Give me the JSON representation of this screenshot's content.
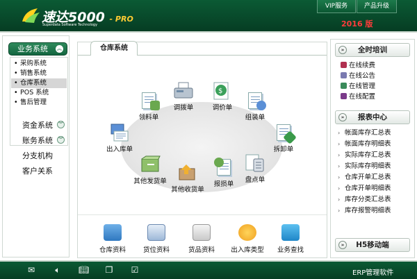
{
  "header": {
    "logo_main": "速达5000",
    "logo_suffix": "- PRO",
    "logo_sub": "Superdata Software Technology",
    "vip_button": "VIP服务",
    "upgrade_button": "产品升级",
    "year": "2016 版"
  },
  "sidebar": {
    "head": "业务系统",
    "sub_items": [
      "采购系统",
      "销售系统",
      "仓库系统",
      "POS 系统",
      "售后管理"
    ],
    "active_index": 2,
    "links": [
      "资金系统",
      "账务系统",
      "分支机构",
      "客户关系"
    ]
  },
  "center": {
    "tab": "仓库系统",
    "nodes": [
      "领料单",
      "调拨单",
      "调价单",
      "组装单",
      "出入库单",
      "拆卸单",
      "其他发货单",
      "其他收货单",
      "报损单",
      "盘点单"
    ],
    "quick": [
      "仓库资料",
      "货位资料",
      "货品资料",
      "出入库类型",
      "业务查找"
    ]
  },
  "right": {
    "training_head": "全时培训",
    "training_items": [
      "在线续费",
      "在线公告",
      "在线管理",
      "在线配置"
    ],
    "report_head": "报表中心",
    "report_items": [
      "帐面库存汇总表",
      "帐面库存明细表",
      "实际库存汇总表",
      "实际库存明细表",
      "仓库开单汇总表",
      "仓库开单明细表",
      "库存分类汇总表",
      "库存报警明细表"
    ],
    "mobile_head": "H5移动端"
  },
  "footer": {
    "label": "ERP管理软件"
  },
  "colors": {
    "brand_green": "#0b5a34",
    "year_red": "#ff3b3b"
  }
}
